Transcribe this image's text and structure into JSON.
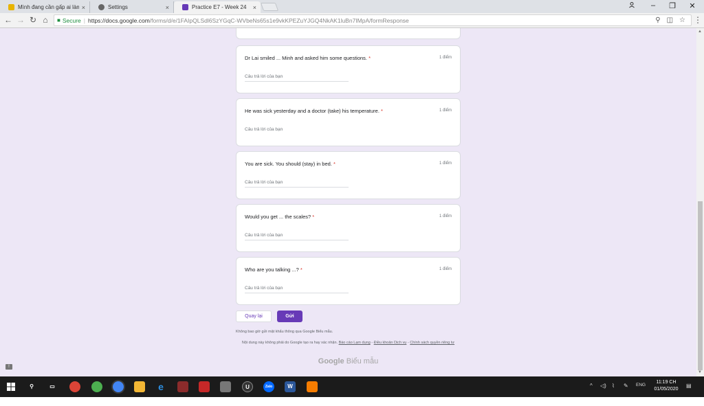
{
  "tabs": [
    {
      "title": "Mình đang cần gấp ai làm",
      "close": "×",
      "favicon_color": "#e8b400",
      "active": false
    },
    {
      "title": "Settings",
      "close": "×",
      "favicon_color": "#666666",
      "active": false
    },
    {
      "title": "Practice E7 - Week 24",
      "close": "×",
      "favicon_color": "#673ab7",
      "active": true
    }
  ],
  "window_controls": {
    "profile_icon": "profile-icon",
    "minimize": "–",
    "restore": "❐",
    "close": "✕"
  },
  "address_bar": {
    "secure_label": "Secure",
    "url_host": "https://docs.google.com",
    "url_path": "/forms/d/e/1FAIpQLSdl6SzYGqC-WVbeNs65s1e9vkKPEZuYJGQ4NkAK1luBn7IMpA/formResponse"
  },
  "questions": [
    {
      "text": "Dr Lai smiled ... Minh and asked him some questions.",
      "required": "*",
      "points": "1 điểm",
      "placeholder": "Câu trả lời của bạn"
    },
    {
      "text": "He was sick yesterday and a doctor (take) his temperature.",
      "required": "*",
      "points": "1 điểm",
      "placeholder": "Câu trả lời của bạn"
    },
    {
      "text": "You are sick. You should (stay) in bed.",
      "required": "*",
      "points": "1 điểm",
      "placeholder": "Câu trả lời của bạn"
    },
    {
      "text": "Would you get ... the scales?",
      "required": "*",
      "points": "1 điểm",
      "placeholder": "Câu trả lời của bạn"
    },
    {
      "text": "Who are you talking ...?",
      "required": "*",
      "points": "1 điểm",
      "placeholder": "Câu trả lời của bạn"
    }
  ],
  "buttons": {
    "back": "Quay lại",
    "submit": "Gửi"
  },
  "footer": {
    "never_submit": "Không bao giờ gửi mật khẩu thông qua Google Biểu mẫu.",
    "disclaimer": "Nội dung này không phải do Google tạo ra hay xác nhận.",
    "report_link": "Báo cáo Lạm dụng",
    "terms_link": "Điều khoản Dịch vụ",
    "privacy_link": "Chính sách quyền riêng tư",
    "dash": " - ",
    "logo_google": "Google",
    "logo_forms": "Biểu mẫu"
  },
  "taskbar": {
    "tray_language": "ENG",
    "time": "11:19 CH",
    "date": "01/05/2020"
  },
  "colors": {
    "accent": "#673ab7",
    "page_bg": "#ede7f6",
    "required": "#d93025"
  }
}
